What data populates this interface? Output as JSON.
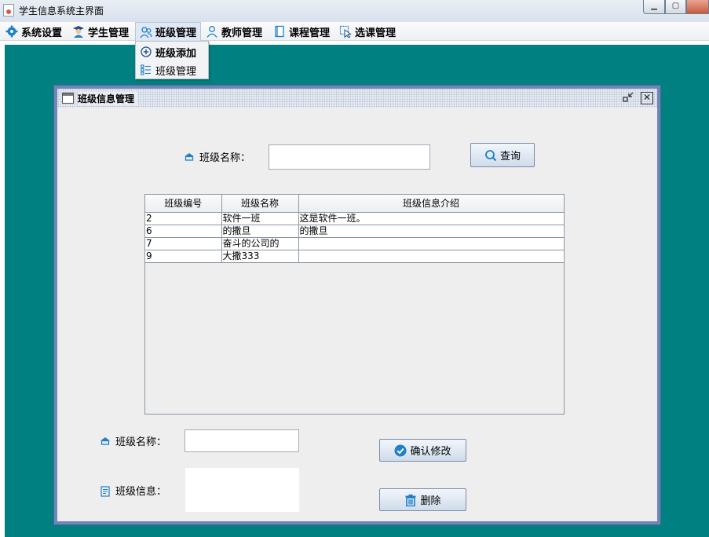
{
  "window": {
    "title": "学生信息系统主界面",
    "icon": "java-app-icon"
  },
  "menubar": {
    "items": [
      {
        "label": "系统设置",
        "icon": "gear-icon"
      },
      {
        "label": "学生管理",
        "icon": "student-icon"
      },
      {
        "label": "班级管理",
        "icon": "class-icon"
      },
      {
        "label": "教师管理",
        "icon": "teacher-icon"
      },
      {
        "label": "课程管理",
        "icon": "course-icon"
      },
      {
        "label": "选课管理",
        "icon": "select-course-icon"
      }
    ],
    "dropdown": [
      {
        "label": "班级添加",
        "icon": "add-circle-icon"
      },
      {
        "label": "班级管理",
        "icon": "list-icon"
      }
    ]
  },
  "frame": {
    "title": "班级信息管理"
  },
  "search": {
    "label": "班级名称：",
    "value": "",
    "button": "查询"
  },
  "table": {
    "columns": [
      "班级编号",
      "班级名称",
      "班级信息介绍"
    ],
    "rows": [
      [
        "2",
        "软件一班",
        "这是软件一班。"
      ],
      [
        "6",
        "的撒旦",
        "的撒旦"
      ],
      [
        "7",
        "奋斗的公司的",
        ""
      ],
      [
        "9",
        "大撒333",
        ""
      ]
    ]
  },
  "edit": {
    "name_label": "班级名称：",
    "name_value": "",
    "info_label": "班级信息：",
    "info_value": "",
    "confirm_button": "确认修改",
    "delete_button": "删除"
  },
  "colors": {
    "desktop": "#008080",
    "frame_border": "#6f87b8",
    "accent_icon": "#1f7fc8"
  }
}
